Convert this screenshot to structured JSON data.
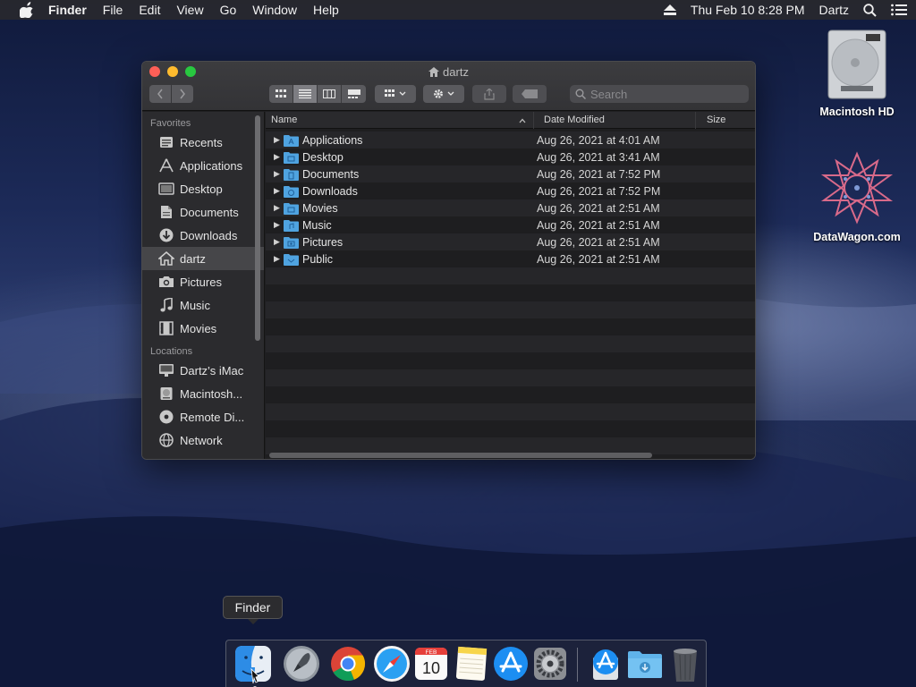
{
  "menubar": {
    "items": [
      "Finder",
      "File",
      "Edit",
      "View",
      "Go",
      "Window",
      "Help"
    ],
    "clock": "Thu Feb 10  8:28 PM",
    "user": "Dartz"
  },
  "desktop": {
    "icons": [
      {
        "label": "Macintosh HD"
      },
      {
        "label": "DataWagon.com"
      }
    ]
  },
  "window": {
    "title": "dartz",
    "search_placeholder": "Search",
    "sidebar": {
      "favorites_header": "Favorites",
      "favorites": [
        {
          "label": "Recents",
          "icon": "recents-icon"
        },
        {
          "label": "Applications",
          "icon": "applications-icon"
        },
        {
          "label": "Desktop",
          "icon": "desktop-icon"
        },
        {
          "label": "Documents",
          "icon": "documents-icon"
        },
        {
          "label": "Downloads",
          "icon": "downloads-icon"
        },
        {
          "label": "dartz",
          "icon": "home-icon",
          "selected": true
        },
        {
          "label": "Pictures",
          "icon": "camera-icon"
        },
        {
          "label": "Music",
          "icon": "music-note-icon"
        },
        {
          "label": "Movies",
          "icon": "film-icon"
        }
      ],
      "locations_header": "Locations",
      "locations": [
        {
          "label": "Dartz’s iMac",
          "icon": "imac-icon"
        },
        {
          "label": "Macintosh...",
          "icon": "hard-drive-icon"
        },
        {
          "label": "Remote Di...",
          "icon": "disc-icon"
        },
        {
          "label": "Network",
          "icon": "globe-icon"
        }
      ]
    },
    "columns": {
      "name": "Name",
      "date": "Date Modified",
      "size": "Size"
    },
    "rows": [
      {
        "name": "Applications",
        "date": "Aug 26, 2021 at 4:01 AM"
      },
      {
        "name": "Desktop",
        "date": "Aug 26, 2021 at 3:41 AM"
      },
      {
        "name": "Documents",
        "date": "Aug 26, 2021 at 7:52 PM"
      },
      {
        "name": "Downloads",
        "date": "Aug 26, 2021 at 7:52 PM"
      },
      {
        "name": "Movies",
        "date": "Aug 26, 2021 at 2:51 AM"
      },
      {
        "name": "Music",
        "date": "Aug 26, 2021 at 2:51 AM"
      },
      {
        "name": "Pictures",
        "date": "Aug 26, 2021 at 2:51 AM"
      },
      {
        "name": "Public",
        "date": "Aug 26, 2021 at 2:51 AM"
      }
    ]
  },
  "dock": {
    "tooltip": "Finder",
    "calendar": {
      "month": "FEB",
      "day": "10"
    },
    "items": [
      "finder-icon",
      "launchpad-icon",
      "chrome-icon",
      "safari-icon",
      "calendar-icon",
      "notes-icon",
      "app-store-icon",
      "system-preferences-icon",
      "app-store-downloads-icon",
      "downloads-folder-icon",
      "trash-icon"
    ]
  },
  "colors": {
    "folder_blue": "#4fa3e0",
    "selection": "#464649",
    "window_bg": "#1f1f21"
  }
}
